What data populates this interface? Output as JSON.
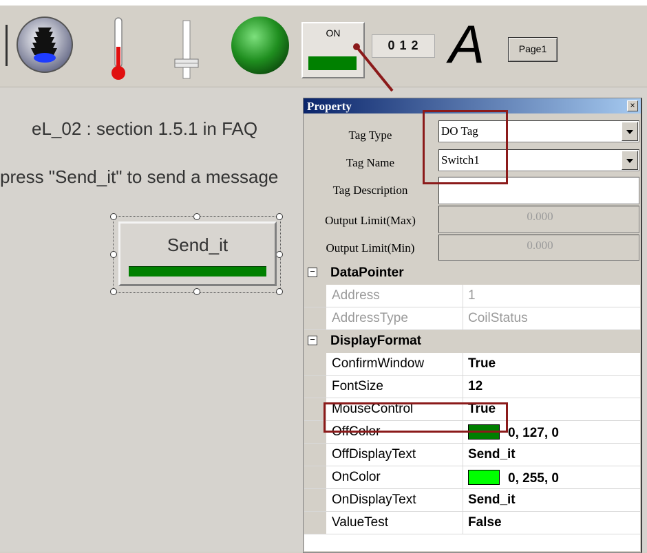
{
  "toolbar": {
    "items": [
      {
        "name": "traffic-light-icon"
      },
      {
        "name": "thermometer-icon"
      },
      {
        "name": "slider-icon"
      },
      {
        "name": "green-led-icon"
      },
      {
        "name": "on-switch-icon",
        "label": "ON"
      },
      {
        "name": "numeric-display-icon",
        "label": "0 1 2"
      },
      {
        "name": "text-label-icon",
        "label": "A"
      },
      {
        "name": "page-button-icon",
        "label": "Page1"
      }
    ]
  },
  "canvas": {
    "line1": "eL_02 : section 1.5.1 in FAQ",
    "line2": "press \"Send_it\" to send a message",
    "button_label": "Send_it"
  },
  "property": {
    "title": "Property",
    "close": "×",
    "tag_type_label": "Tag Type",
    "tag_type_value": "DO Tag",
    "tag_name_label": "Tag Name",
    "tag_name_value": "Switch1",
    "tag_desc_label": "Tag Description",
    "tag_desc_value": "",
    "out_max_label": "Output Limit(Max)",
    "out_max_value": "0.000",
    "out_min_label": "Output Limit(Min)",
    "out_min_value": "0.000",
    "groups": [
      {
        "name": "DataPointer",
        "rows": [
          {
            "name": "Address",
            "value": "1",
            "readonly": true
          },
          {
            "name": "AddressType",
            "value": "CoilStatus",
            "readonly": true
          }
        ]
      },
      {
        "name": "DisplayFormat",
        "rows": [
          {
            "name": "ConfirmWindow",
            "value": "True"
          },
          {
            "name": "FontSize",
            "value": "12"
          },
          {
            "name": "MouseControl",
            "value": "True"
          },
          {
            "name": "OffColor",
            "value": "0, 127, 0",
            "swatch": "#007f00"
          },
          {
            "name": "OffDisplayText",
            "value": "Send_it"
          },
          {
            "name": "OnColor",
            "value": "0, 255, 0",
            "swatch": "#00ff00"
          },
          {
            "name": "OnDisplayText",
            "value": "Send_it"
          },
          {
            "name": "ValueTest",
            "value": "False"
          }
        ]
      }
    ]
  },
  "colors": {
    "annotation": "#8b1a1a",
    "title_bar": "#0a246a",
    "button_bar": "#008000"
  }
}
